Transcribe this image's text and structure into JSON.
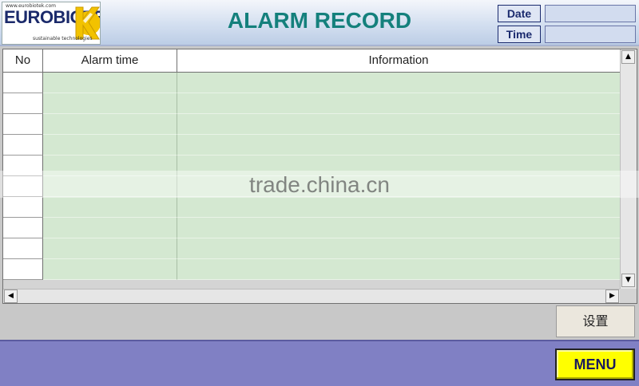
{
  "header": {
    "logo": {
      "url_text": "www.eurobiotek.com",
      "brand": "EUROBIOTE",
      "tagline": "sustainable technologies"
    },
    "title": "ALARM RECORD",
    "date_label": "Date",
    "date_value": "",
    "time_label": "Time",
    "time_value": ""
  },
  "table": {
    "columns": [
      "No",
      "Alarm time",
      "Information"
    ],
    "rows": [
      {
        "no": "",
        "time": "",
        "info": ""
      },
      {
        "no": "",
        "time": "",
        "info": ""
      },
      {
        "no": "",
        "time": "",
        "info": ""
      },
      {
        "no": "",
        "time": "",
        "info": ""
      },
      {
        "no": "",
        "time": "",
        "info": ""
      },
      {
        "no": "",
        "time": "",
        "info": ""
      },
      {
        "no": "",
        "time": "",
        "info": ""
      },
      {
        "no": "",
        "time": "",
        "info": ""
      },
      {
        "no": "",
        "time": "",
        "info": ""
      },
      {
        "no": "",
        "time": "",
        "info": ""
      }
    ]
  },
  "buttons": {
    "settings_label": "设置",
    "menu_label": "MENU"
  },
  "watermark": "trade.china.cn",
  "colors": {
    "title": "#14807c",
    "row_fill": "#d4e8d1",
    "bottom_bar": "#8080c4",
    "menu_button": "#ffff00"
  }
}
